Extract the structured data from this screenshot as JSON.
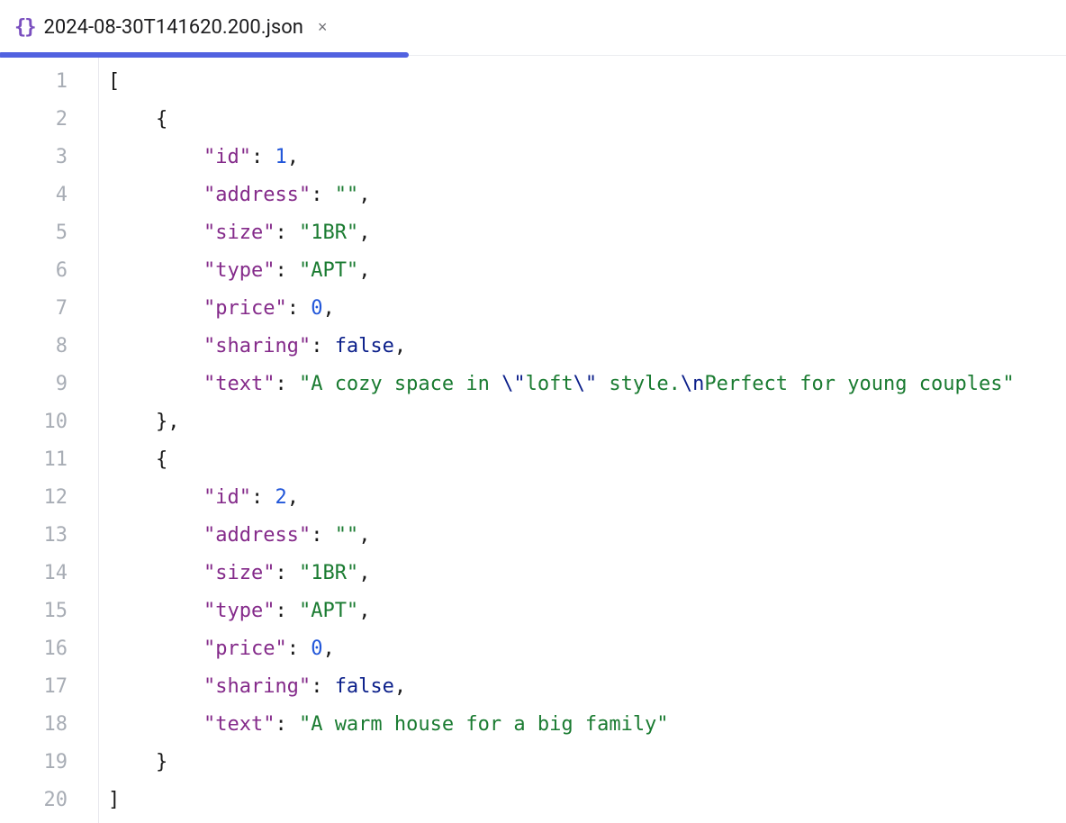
{
  "tab": {
    "filename": "2024-08-30T141620.200.json",
    "icon": "{}",
    "close_glyph": "×"
  },
  "editor": {
    "line_numbers": [
      "1",
      "2",
      "3",
      "4",
      "5",
      "6",
      "7",
      "8",
      "9",
      "10",
      "11",
      "12",
      "13",
      "14",
      "15",
      "16",
      "17",
      "18",
      "19",
      "20"
    ],
    "lines": [
      {
        "indent": 0,
        "tokens": [
          {
            "t": "p",
            "v": "["
          }
        ]
      },
      {
        "indent": 1,
        "tokens": [
          {
            "t": "p",
            "v": "{"
          }
        ]
      },
      {
        "indent": 2,
        "tokens": [
          {
            "t": "k",
            "v": "\"id\""
          },
          {
            "t": "p",
            "v": ": "
          },
          {
            "t": "n",
            "v": "1"
          },
          {
            "t": "p",
            "v": ","
          }
        ]
      },
      {
        "indent": 2,
        "tokens": [
          {
            "t": "k",
            "v": "\"address\""
          },
          {
            "t": "p",
            "v": ": "
          },
          {
            "t": "s",
            "v": "\"\""
          },
          {
            "t": "p",
            "v": ","
          }
        ]
      },
      {
        "indent": 2,
        "tokens": [
          {
            "t": "k",
            "v": "\"size\""
          },
          {
            "t": "p",
            "v": ": "
          },
          {
            "t": "s",
            "v": "\"1BR\""
          },
          {
            "t": "p",
            "v": ","
          }
        ]
      },
      {
        "indent": 2,
        "tokens": [
          {
            "t": "k",
            "v": "\"type\""
          },
          {
            "t": "p",
            "v": ": "
          },
          {
            "t": "s",
            "v": "\"APT\""
          },
          {
            "t": "p",
            "v": ","
          }
        ]
      },
      {
        "indent": 2,
        "tokens": [
          {
            "t": "k",
            "v": "\"price\""
          },
          {
            "t": "p",
            "v": ": "
          },
          {
            "t": "n",
            "v": "0"
          },
          {
            "t": "p",
            "v": ","
          }
        ]
      },
      {
        "indent": 2,
        "tokens": [
          {
            "t": "k",
            "v": "\"sharing\""
          },
          {
            "t": "p",
            "v": ": "
          },
          {
            "t": "b",
            "v": "false"
          },
          {
            "t": "p",
            "v": ","
          }
        ]
      },
      {
        "indent": 2,
        "tokens": [
          {
            "t": "k",
            "v": "\"text\""
          },
          {
            "t": "p",
            "v": ": "
          },
          {
            "t": "s",
            "v": "\"A cozy space in "
          },
          {
            "t": "e",
            "v": "\\\""
          },
          {
            "t": "s",
            "v": "loft"
          },
          {
            "t": "e",
            "v": "\\\""
          },
          {
            "t": "s",
            "v": " style."
          },
          {
            "t": "e",
            "v": "\\n"
          },
          {
            "t": "s",
            "v": "Perfect for young couples\""
          }
        ]
      },
      {
        "indent": 1,
        "tokens": [
          {
            "t": "p",
            "v": "},"
          }
        ]
      },
      {
        "indent": 1,
        "tokens": [
          {
            "t": "p",
            "v": "{"
          }
        ]
      },
      {
        "indent": 2,
        "tokens": [
          {
            "t": "k",
            "v": "\"id\""
          },
          {
            "t": "p",
            "v": ": "
          },
          {
            "t": "n",
            "v": "2"
          },
          {
            "t": "p",
            "v": ","
          }
        ]
      },
      {
        "indent": 2,
        "tokens": [
          {
            "t": "k",
            "v": "\"address\""
          },
          {
            "t": "p",
            "v": ": "
          },
          {
            "t": "s",
            "v": "\"\""
          },
          {
            "t": "p",
            "v": ","
          }
        ]
      },
      {
        "indent": 2,
        "tokens": [
          {
            "t": "k",
            "v": "\"size\""
          },
          {
            "t": "p",
            "v": ": "
          },
          {
            "t": "s",
            "v": "\"1BR\""
          },
          {
            "t": "p",
            "v": ","
          }
        ]
      },
      {
        "indent": 2,
        "tokens": [
          {
            "t": "k",
            "v": "\"type\""
          },
          {
            "t": "p",
            "v": ": "
          },
          {
            "t": "s",
            "v": "\"APT\""
          },
          {
            "t": "p",
            "v": ","
          }
        ]
      },
      {
        "indent": 2,
        "tokens": [
          {
            "t": "k",
            "v": "\"price\""
          },
          {
            "t": "p",
            "v": ": "
          },
          {
            "t": "n",
            "v": "0"
          },
          {
            "t": "p",
            "v": ","
          }
        ]
      },
      {
        "indent": 2,
        "tokens": [
          {
            "t": "k",
            "v": "\"sharing\""
          },
          {
            "t": "p",
            "v": ": "
          },
          {
            "t": "b",
            "v": "false"
          },
          {
            "t": "p",
            "v": ","
          }
        ]
      },
      {
        "indent": 2,
        "tokens": [
          {
            "t": "k",
            "v": "\"text\""
          },
          {
            "t": "p",
            "v": ": "
          },
          {
            "t": "s",
            "v": "\"A warm house for a big family\""
          }
        ]
      },
      {
        "indent": 1,
        "tokens": [
          {
            "t": "p",
            "v": "}"
          }
        ]
      },
      {
        "indent": 0,
        "tokens": [
          {
            "t": "p",
            "v": "]"
          }
        ]
      }
    ]
  }
}
